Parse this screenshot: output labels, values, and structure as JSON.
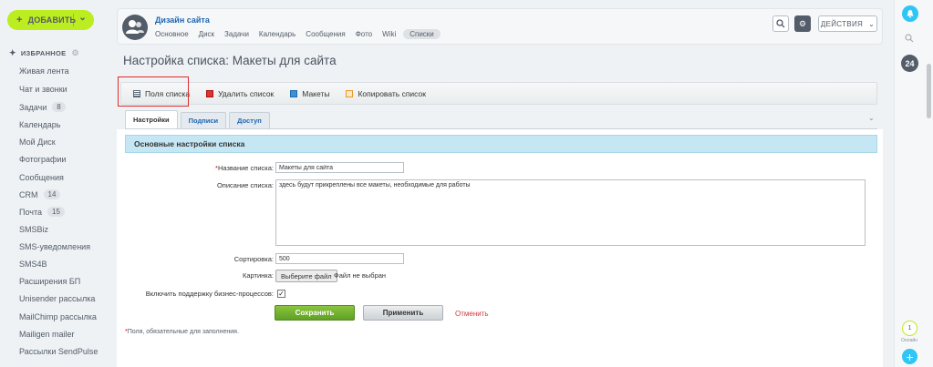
{
  "sidebar": {
    "add_label": "ДОБАВИТЬ",
    "favorites_label": "ИЗБРАННОЕ",
    "items": [
      {
        "label": "Живая лента",
        "badge": null
      },
      {
        "label": "Чат и звонки",
        "badge": null
      },
      {
        "label": "Задачи",
        "badge": "8"
      },
      {
        "label": "Календарь",
        "badge": null
      },
      {
        "label": "Мой Диск",
        "badge": null
      },
      {
        "label": "Фотографии",
        "badge": null
      },
      {
        "label": "Сообщения",
        "badge": null
      },
      {
        "label": "CRM",
        "badge": "14"
      },
      {
        "label": "Почта",
        "badge": "15"
      },
      {
        "label": "SMSBiz",
        "badge": null
      },
      {
        "label": "SMS-уведомления",
        "badge": null
      },
      {
        "label": "SMS4B",
        "badge": null
      },
      {
        "label": "Расширения БП",
        "badge": null
      },
      {
        "label": "Unisender рассылка",
        "badge": null
      },
      {
        "label": "MailChimp рассылка",
        "badge": null
      },
      {
        "label": "Mailigen mailer",
        "badge": null
      },
      {
        "label": "Рассылки SendPulse",
        "badge": null
      }
    ]
  },
  "header": {
    "group_title": "Дизайн сайта",
    "tabs": [
      "Основное",
      "Диск",
      "Задачи",
      "Календарь",
      "Сообщения",
      "Фото",
      "Wiki",
      "Списки"
    ],
    "active_tab": "Списки",
    "actions_label": "ДЕЙСТВИЯ"
  },
  "page": {
    "title": "Настройка списка: Макеты для сайта"
  },
  "toolbar": {
    "fields_label": "Поля списка",
    "delete_label": "Удалить список",
    "mockups_label": "Макеты",
    "copy_label": "Копировать список"
  },
  "tabs": [
    "Настройки",
    "Подписи",
    "Доступ"
  ],
  "form": {
    "section_title": "Основные настройки списка",
    "name_label": "Название списка:",
    "name_value": "Макеты для сайта",
    "description_label": "Описание списка:",
    "description_value": "здесь будут прикреплены все макеты, необходимые для работы",
    "sort_label": "Сортировка:",
    "sort_value": "500",
    "picture_label": "Картинка:",
    "file_button": "Выберите файл",
    "file_status": "Файл не выбран",
    "bp_label": "Включить поддержку бизнес-процессов:",
    "bp_checked": true,
    "save_label": "Сохранить",
    "apply_label": "Применить",
    "cancel_label": "Отменить",
    "required_note": "Поля, обязательные для заполнения."
  },
  "rightbar": {
    "counter": "24",
    "online_count": "1",
    "online_label": "Онлайн"
  },
  "colors": {
    "accent_green": "#bbed21",
    "link_blue": "#2067b0",
    "section_blue": "#c5e7f4",
    "highlight_red": "#e02a2a",
    "bell_blue": "#2fc6f6"
  }
}
